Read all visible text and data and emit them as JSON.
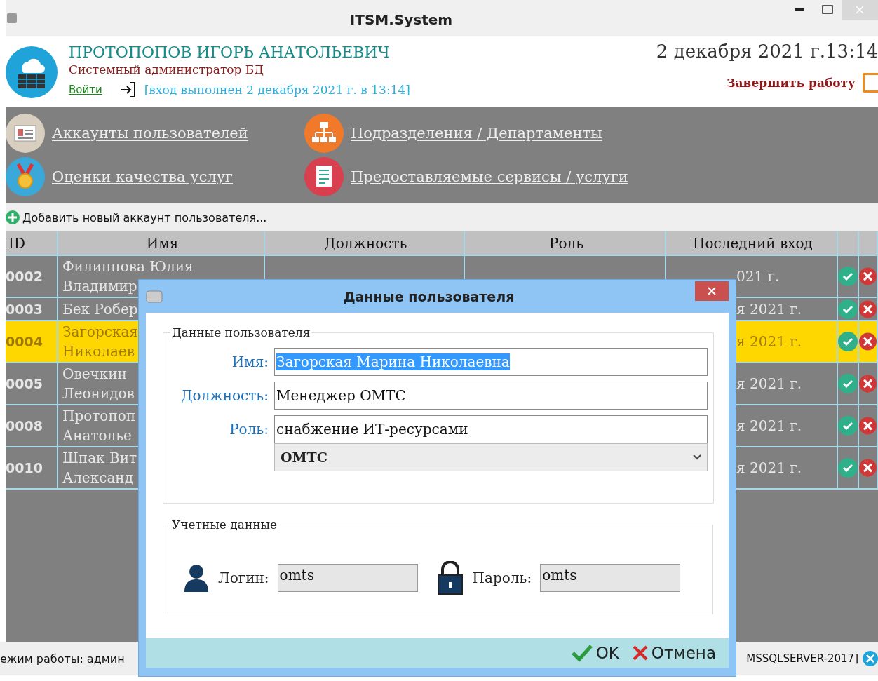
{
  "window": {
    "title": "ITSM.System"
  },
  "header": {
    "user_name": "ПРОТОПОПОВ ИГОРЬ АНАТОЛЬЕВИЧ",
    "user_role": "Системный администратор БД",
    "login_link": "Войти",
    "login_info": "[вход выполнен 2 декабря 2021 г. в 13:14]",
    "datetime": "2 декабря 2021 г.13:14",
    "logout_link": "Завершить работу"
  },
  "nav": [
    {
      "label": "Аккаунты пользователей",
      "kind": "accounts"
    },
    {
      "label": "Подразделения / Департаменты",
      "kind": "departments"
    },
    {
      "label": "Оценки качества услуг",
      "kind": "medal"
    },
    {
      "label": "Предоставляемые сервисы / услуги",
      "kind": "services"
    }
  ],
  "toolbar": {
    "add_label": "Добавить новый аккаунт пользователя..."
  },
  "table": {
    "columns": [
      "ID",
      "Имя",
      "Должность",
      "Роль",
      "Последний вход"
    ],
    "rows": [
      {
        "id": "0002",
        "name": [
          "Филиппова Юлия",
          "Владимир"
        ],
        "last_login": "021 г.",
        "selected": false
      },
      {
        "id": "0003",
        "name": [
          "Бек Робер"
        ],
        "last_login": "я 2021 г.",
        "selected": false
      },
      {
        "id": "0004",
        "name": [
          "Загорская",
          "Николаев"
        ],
        "last_login": "я 2021 г.",
        "selected": true
      },
      {
        "id": "0005",
        "name": [
          "Овечкин",
          "Леонидов"
        ],
        "last_login": "я 2021 г.",
        "selected": false
      },
      {
        "id": "0008",
        "name": [
          "Протопоп",
          "Анатолье"
        ],
        "last_login": "я 2021 г.",
        "selected": false
      },
      {
        "id": "0010",
        "name": [
          "Шпак Вит",
          "Александ"
        ],
        "last_login": "я 2021 г.",
        "selected": false
      }
    ]
  },
  "status_bar": {
    "left": "ежим работы: админ",
    "right": "MSSQLSERVER-2017]"
  },
  "dialog": {
    "title": "Данные пользователя",
    "group_user": "Данные пользователя",
    "fields": [
      {
        "label": "Имя:",
        "value": "Загорская Марина Николаевна",
        "text_selected": true
      },
      {
        "label": "Должность:",
        "value": "Менеджер ОМТС",
        "text_selected": false
      },
      {
        "label": "Роль:",
        "value": "снабжение ИТ-ресурсами",
        "text_selected": false
      }
    ],
    "department_select": "ОМТС",
    "group_credentials": "Учетные данные",
    "login_label": "Логин:",
    "login_value": "omts",
    "password_label": "Пароль:",
    "password_value": "omts",
    "ok": "OK",
    "cancel": "Отмена"
  }
}
